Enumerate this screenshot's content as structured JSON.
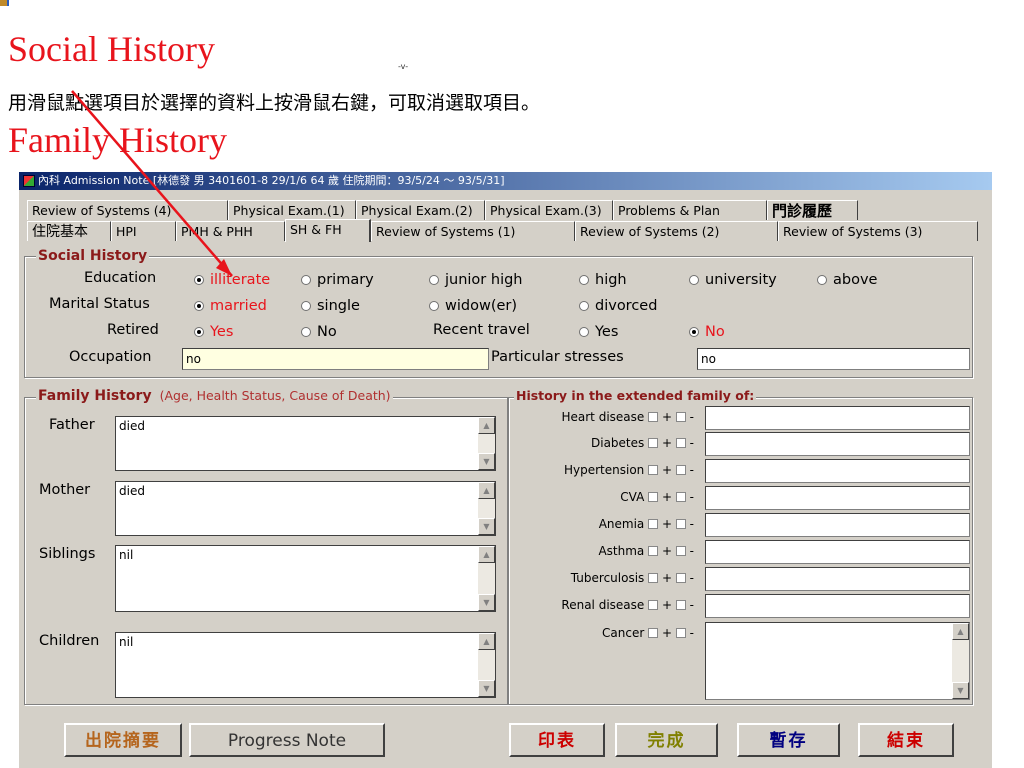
{
  "slide": {
    "title_social": "Social History",
    "instruction": "用滑鼠點選項目於選擇的資料上按滑鼠右鍵，可取消選取項目。",
    "title_family": "Family History",
    "small_mark": "-v-"
  },
  "window": {
    "title": "內科 Admission Note [林德發  男  3401601-8  29/1/6  64 歲  住院期間：93/5/24 ～ 93/5/31]"
  },
  "tabs": {
    "row1": [
      "Review of Systems (4)",
      "Physical Exam.(1)",
      "Physical Exam.(2)",
      "Physical Exam.(3)",
      "Problems & Plan",
      "門診履歷"
    ],
    "row2": [
      "住院基本",
      "HPI",
      "PMH & PHH",
      "SH & FH",
      "Review of Systems (1)",
      "Review of Systems (2)",
      "Review of Systems (3)"
    ],
    "active": "SH & FH"
  },
  "social_history": {
    "legend": "Social History",
    "education": {
      "label": "Education",
      "options": [
        "illiterate",
        "primary",
        "junior high",
        "high",
        "university",
        "above"
      ],
      "selected": "illiterate"
    },
    "marital": {
      "label": "Marital Status",
      "options": [
        "married",
        "single",
        "widow(er)",
        "divorced"
      ],
      "selected": "married"
    },
    "retired": {
      "label": "Retired",
      "options": [
        "Yes",
        "No"
      ],
      "selected": "Yes"
    },
    "travel": {
      "label": "Recent travel",
      "options": [
        "Yes",
        "No"
      ],
      "selected": "No"
    },
    "occupation": {
      "label": "Occupation",
      "value": "no"
    },
    "stresses": {
      "label": "Particular stresses",
      "value": "no"
    }
  },
  "family_history": {
    "legend": "Family History",
    "note": "(Age, Health Status, Cause of Death)",
    "members": [
      {
        "label": "Father",
        "value": "died"
      },
      {
        "label": "Mother",
        "value": "died"
      },
      {
        "label": "Siblings",
        "value": "nil"
      },
      {
        "label": "Children",
        "value": "nil"
      }
    ]
  },
  "extended_family": {
    "legend": "History in the extended family of:",
    "plus": "+",
    "minus": "-",
    "diseases": [
      "Heart disease",
      "Diabetes",
      "Hypertension",
      "CVA",
      "Anemia",
      "Asthma",
      "Tuberculosis",
      "Renal disease",
      "Cancer"
    ]
  },
  "buttons": {
    "discharge_summary": "出院摘要",
    "progress_note": "Progress Note",
    "print": "印表",
    "complete": "完成",
    "save_draft": "暫存",
    "end": "結束"
  },
  "colors": {
    "title_red": "#e8141c",
    "legend_red": "#8b1a1a",
    "arrow": "#e8141c",
    "button_brown": "#b5651d",
    "button_olive": "#808000",
    "button_red": "#cc0000",
    "button_navy": "#000080"
  }
}
